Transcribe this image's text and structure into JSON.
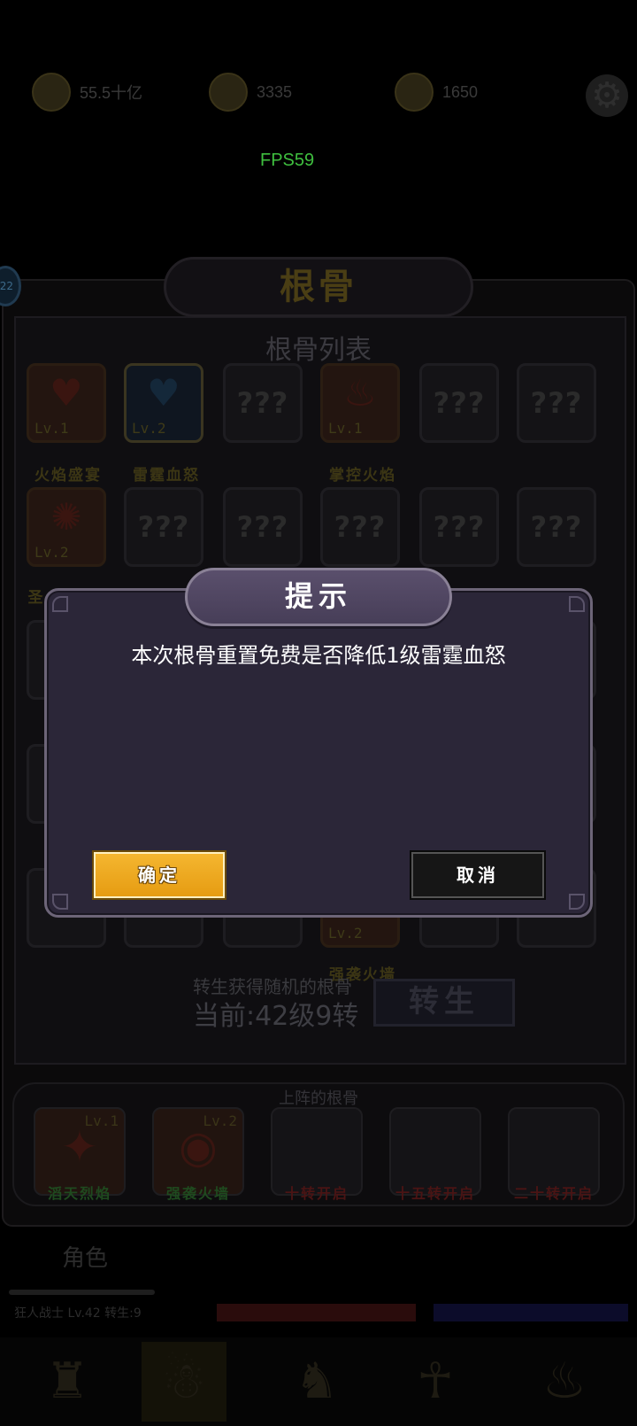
{
  "fps": "FPS59",
  "currencies": [
    {
      "icon": "coin-icon",
      "value": "55.5十亿"
    },
    {
      "icon": "gem-pile-icon",
      "value": "3335"
    },
    {
      "icon": "scroll-icon",
      "value": "1650"
    }
  ],
  "panel": {
    "title": "根骨",
    "list_title": "根骨列表",
    "badge": "22",
    "slots_row1": [
      {
        "label": "Lv.1",
        "name": "火焰盛宴",
        "icon": "flaming-heart-icon"
      },
      {
        "label": "Lv.2",
        "name": "雷霆血怒",
        "icon": "broken-blue-heart-icon"
      },
      {
        "label": "???",
        "name": ""
      },
      {
        "label": "Lv.1",
        "name": "掌控火焰",
        "icon": "flame-icon"
      },
      {
        "label": "???",
        "name": ""
      },
      {
        "label": "???",
        "name": ""
      }
    ],
    "slots_row2": [
      {
        "label": "Lv.2",
        "name": "圣",
        "icon": "fire-rune-icon"
      },
      {
        "label": "???"
      },
      {
        "label": "???"
      },
      {
        "label": "???"
      },
      {
        "label": "???"
      },
      {
        "label": "???"
      }
    ],
    "bottom_slot": {
      "label": "Lv.2",
      "name": "强袭火墙"
    },
    "reborn_desc": "转生获得随机的根骨",
    "reborn_current": "当前:42级9转",
    "reborn_button": "转生"
  },
  "deployed": {
    "title": "上阵的根骨",
    "slots": [
      {
        "level": "Lv.1",
        "name": "滔天烈焰",
        "color": "green"
      },
      {
        "level": "Lv.2",
        "name": "强袭火墙",
        "color": "green"
      },
      {
        "level": "",
        "name": "十转开启",
        "color": "red"
      },
      {
        "level": "",
        "name": "十五转开启",
        "color": "red"
      },
      {
        "level": "",
        "name": "二十转开启",
        "color": "red"
      }
    ]
  },
  "bottom": {
    "tab_active": "角色",
    "status": "狂人战士 Lv.42 转生:9"
  },
  "dialog": {
    "title": "提示",
    "message": "本次根骨重置免费是否降低1级雷霆血怒",
    "confirm": "确定",
    "cancel": "取消"
  },
  "colors": {
    "dialog_bg": "#2b2638",
    "confirm_bg": "#f0aa20",
    "cancel_bg": "#161616"
  }
}
